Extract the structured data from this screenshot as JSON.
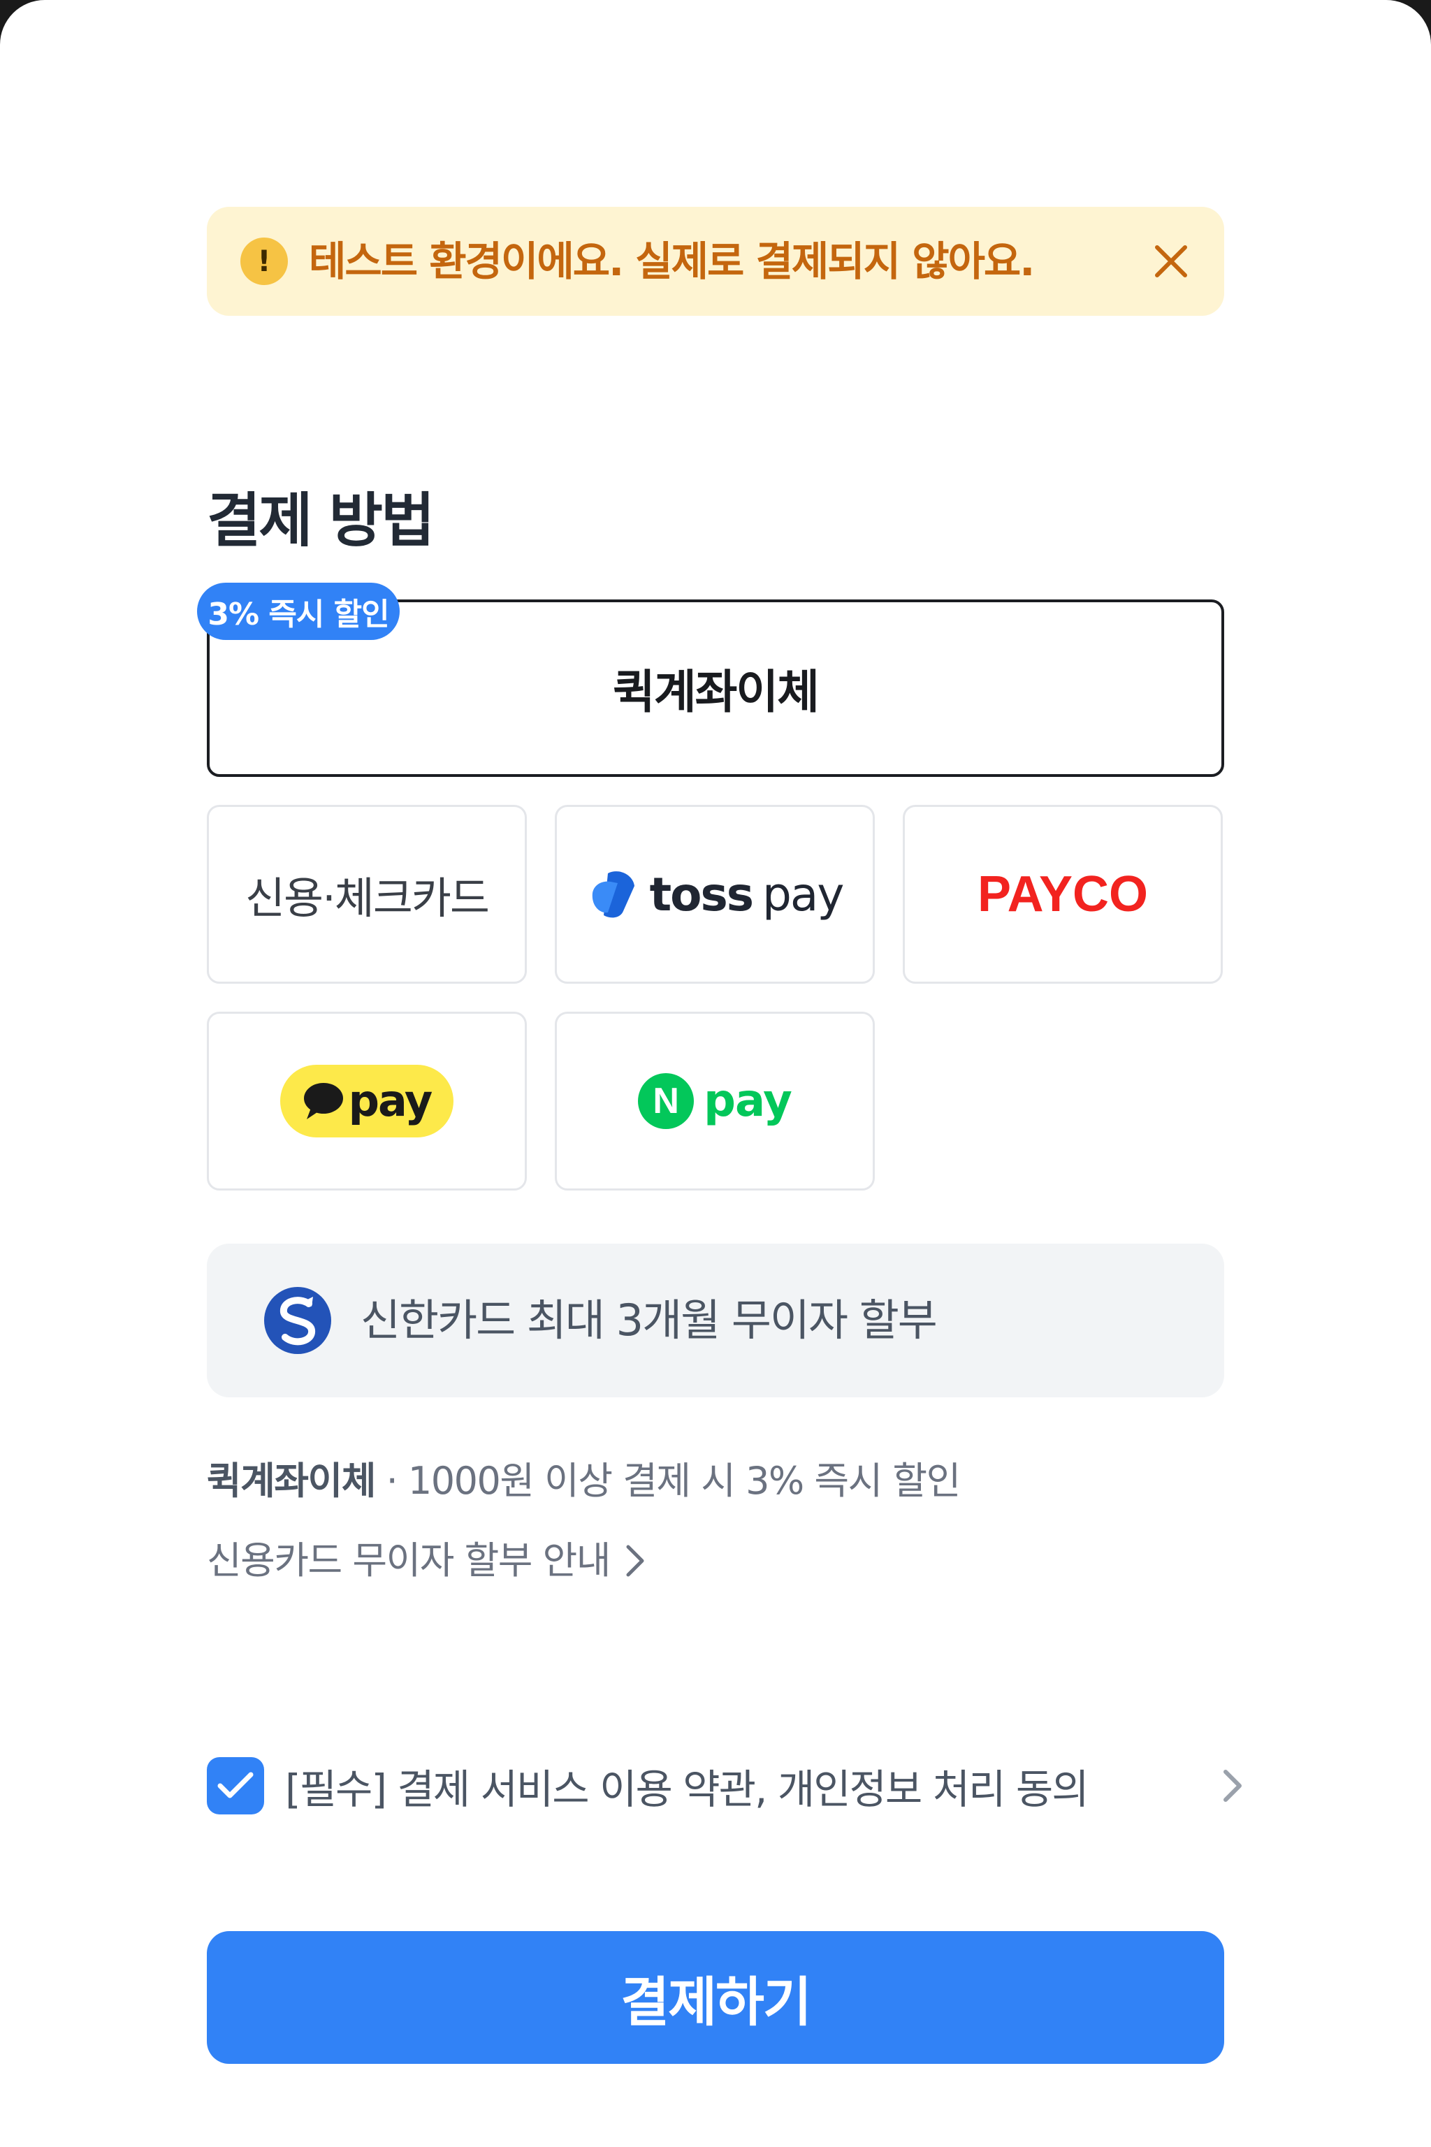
{
  "banner": {
    "message": "테스트 환경이에요. 실제로 결제되지 않아요.",
    "alert_icon": "!",
    "icons": [
      "alert-icon",
      "close-icon"
    ]
  },
  "payment_method": {
    "title": "결제 방법",
    "quick_transfer": {
      "label": "퀵계좌이체",
      "badge": "3% 즉시 할인"
    },
    "options": {
      "card": "신용·체크카드",
      "tosspay": {
        "brand": "toss",
        "suffix": "pay"
      },
      "payco": "PAYCO",
      "kakaopay": "pay",
      "naverpay": {
        "mark": "N",
        "word": "pay"
      }
    },
    "brand_colors": {
      "toss_blue": "#3182f6",
      "payco_red": "#f2231f",
      "kakao_yellow": "#fde94a",
      "naver_green": "#03c75a"
    }
  },
  "promo": {
    "text": "신한카드 최대 3개월 무이자 할부",
    "icon": "shinhan-logo-icon"
  },
  "info": {
    "quick_name": "퀵계좌이체",
    "quick_desc": " · 1000원 이상 결제 시 3% 즉시 할인",
    "installment_link": "신용카드 무이자 할부 안내"
  },
  "terms": {
    "label": "[필수] 결제 서비스 이용 약관, 개인정보 처리 동의",
    "checked": true
  },
  "pay_button": {
    "label": "결제하기",
    "color": "#3182f6"
  }
}
